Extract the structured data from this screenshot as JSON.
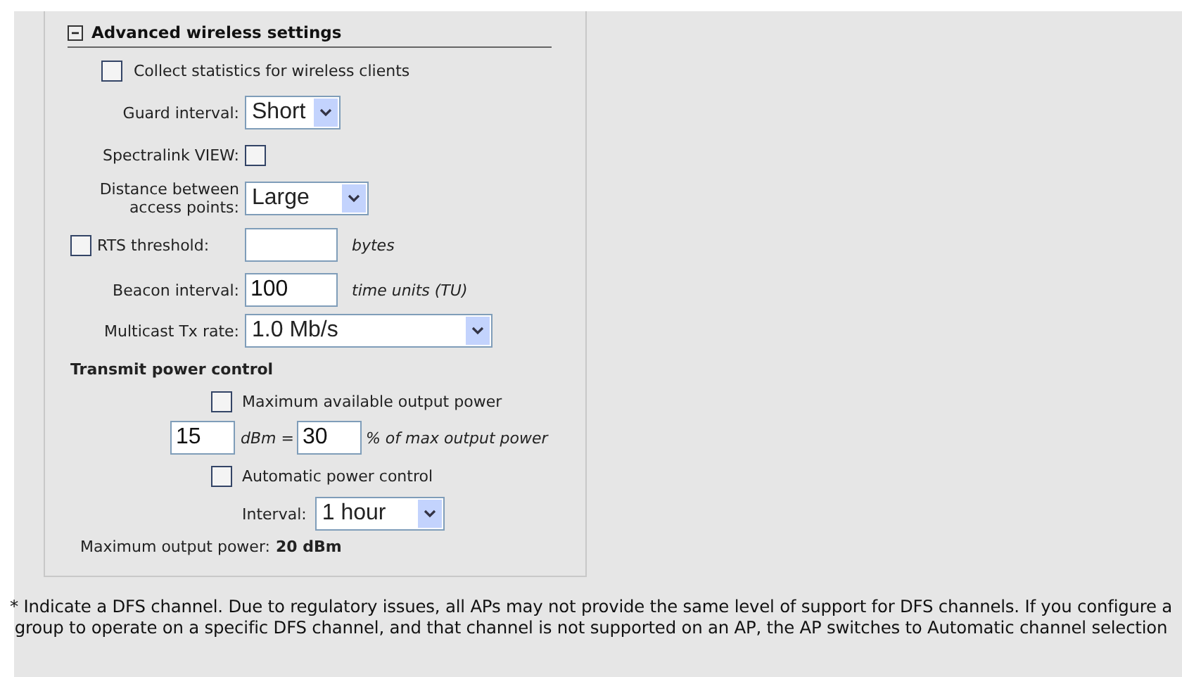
{
  "section": {
    "title": "Advanced wireless settings",
    "expanded": true
  },
  "collect_stats": {
    "label": "Collect statistics for wireless clients",
    "checked": false
  },
  "guard_interval": {
    "label": "Guard interval:",
    "value": "Short"
  },
  "spectralink": {
    "label": "Spectralink VIEW:",
    "checked": false
  },
  "distance": {
    "label": "Distance between access points:",
    "value": "Large"
  },
  "rts": {
    "label": "RTS threshold:",
    "checked": false,
    "unit": "bytes"
  },
  "beacon": {
    "label": "Beacon interval:",
    "value": "100",
    "unit": "time units (TU)"
  },
  "multicast": {
    "label": "Multicast Tx rate:",
    "value": "1.0 Mb/s"
  },
  "transmit_power": {
    "title": "Transmit power control",
    "max_available": {
      "label": "Maximum available output power",
      "checked": false
    },
    "dbm_value": "15",
    "dbm_unit": "dBm =",
    "percent_value": "30",
    "percent_unit": "% of max output power",
    "auto_control": {
      "label": "Automatic power control",
      "checked": false
    },
    "interval": {
      "label": "Interval:",
      "value": "1 hour"
    },
    "max_output": {
      "label": "Maximum output power:",
      "value": "20 dBm"
    }
  },
  "footnote": "* Indicate a DFS channel. Due to regulatory issues, all APs may not provide the same level of support for DFS channels. If you configure a group to operate on a specific DFS channel, and that channel is not supported on an AP, the AP switches to Automatic channel selection"
}
